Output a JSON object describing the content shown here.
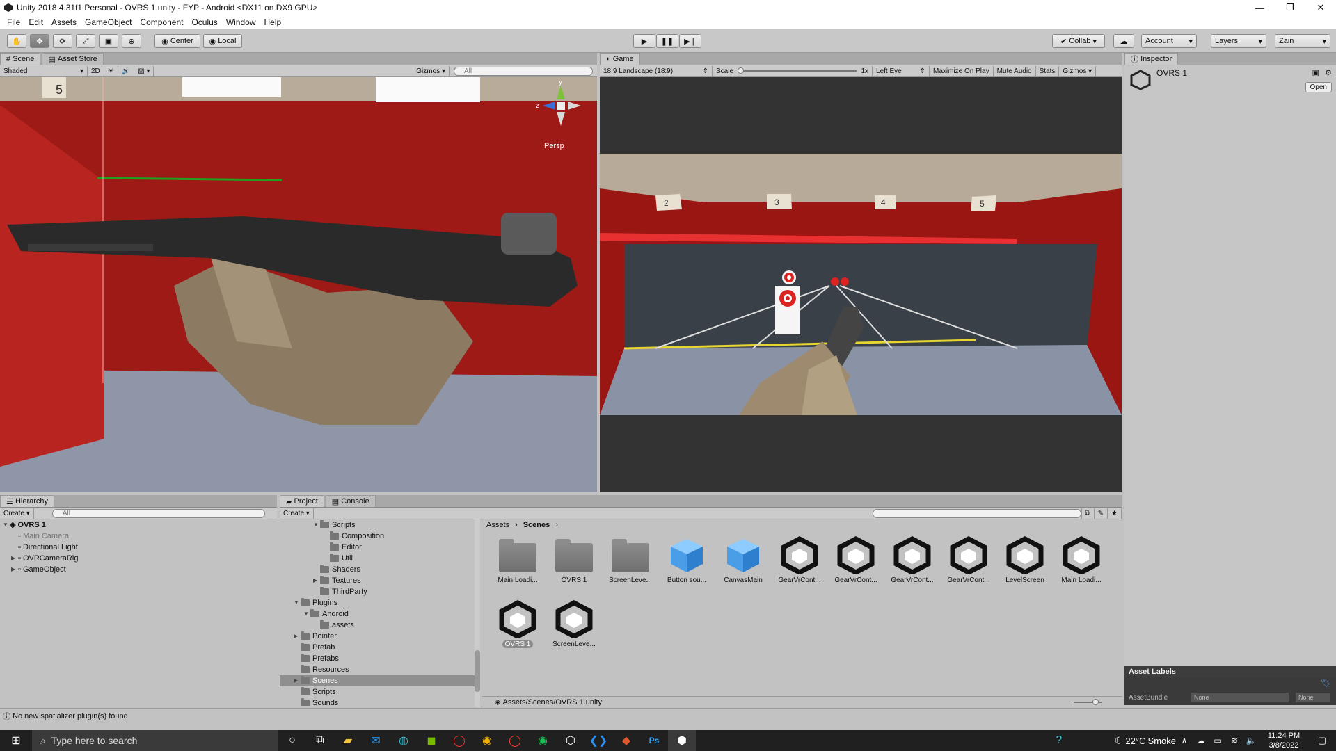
{
  "window": {
    "title": "Unity 2018.4.31f1 Personal - OVRS 1.unity - FYP - Android <DX11 on DX9 GPU>"
  },
  "menu": [
    "File",
    "Edit",
    "Assets",
    "GameObject",
    "Component",
    "Oculus",
    "Window",
    "Help"
  ],
  "toolbar": {
    "center": "Center",
    "local": "Local",
    "collab": "Collab",
    "account": "Account",
    "layers": "Layers",
    "layout": "Zain"
  },
  "scene": {
    "tab": "Scene",
    "asset_store": "Asset Store",
    "shaded": "Shaded",
    "mode2d": "2D",
    "gizmos": "Gizmos",
    "search": "All",
    "persp": "Persp",
    "axis_y": "y",
    "axis_z": "z"
  },
  "game": {
    "tab": "Game",
    "resolution": "18:9 Landscape (18:9)",
    "scale": "Scale",
    "scale_val": "1x",
    "eye": "Left Eye",
    "max": "Maximize On Play",
    "mute": "Mute Audio",
    "stats": "Stats",
    "gizmos": "Gizmos",
    "lanes": [
      "2",
      "3",
      "4",
      "5"
    ]
  },
  "inspector": {
    "tab": "Inspector",
    "object": "OVRS 1",
    "open": "Open",
    "asset_labels": "Asset Labels",
    "bundle": "AssetBundle",
    "bundle_val": "None",
    "variant_val": "None"
  },
  "hierarchy": {
    "tab": "Hierarchy",
    "create": "Create",
    "search": "All",
    "scene": "OVRS 1",
    "items": [
      "Main Camera",
      "Directional Light",
      "OVRCameraRig",
      "GameObject"
    ]
  },
  "project": {
    "tab": "Project",
    "console": "Console",
    "create": "Create",
    "tree": [
      "Scripts",
      "Composition",
      "Editor",
      "Util",
      "Shaders",
      "Textures",
      "ThirdParty",
      "Plugins",
      "Android",
      "assets",
      "Pointer",
      "Prefab",
      "Prefabs",
      "Resources",
      "Scenes",
      "Scripts",
      "Sounds"
    ],
    "crumb1": "Assets",
    "crumb2": "Scenes",
    "assets": [
      {
        "name": "Main Loadi...",
        "type": "folder"
      },
      {
        "name": "OVRS 1",
        "type": "folder"
      },
      {
        "name": "ScreenLeve...",
        "type": "folder"
      },
      {
        "name": "Button sou...",
        "type": "cube"
      },
      {
        "name": "CanvasMain",
        "type": "cube"
      },
      {
        "name": "GearVrCont...",
        "type": "unity"
      },
      {
        "name": "GearVrCont...",
        "type": "unity"
      },
      {
        "name": "GearVrCont...",
        "type": "unity"
      },
      {
        "name": "GearVrCont...",
        "type": "unity"
      },
      {
        "name": "LevelScreen",
        "type": "unity"
      },
      {
        "name": "Main Loadi...",
        "type": "unity"
      },
      {
        "name": "OVRS 1",
        "type": "unity"
      },
      {
        "name": "ScreenLeve...",
        "type": "unity"
      }
    ],
    "path": "Assets/Scenes/OVRS 1.unity"
  },
  "status": {
    "message": "No new spatializer plugin(s) found"
  },
  "taskbar": {
    "search": "Type here to search",
    "weather_temp": "22°C",
    "weather_text": "Smoke",
    "time": "11:24 PM",
    "date": "3/8/2022"
  }
}
